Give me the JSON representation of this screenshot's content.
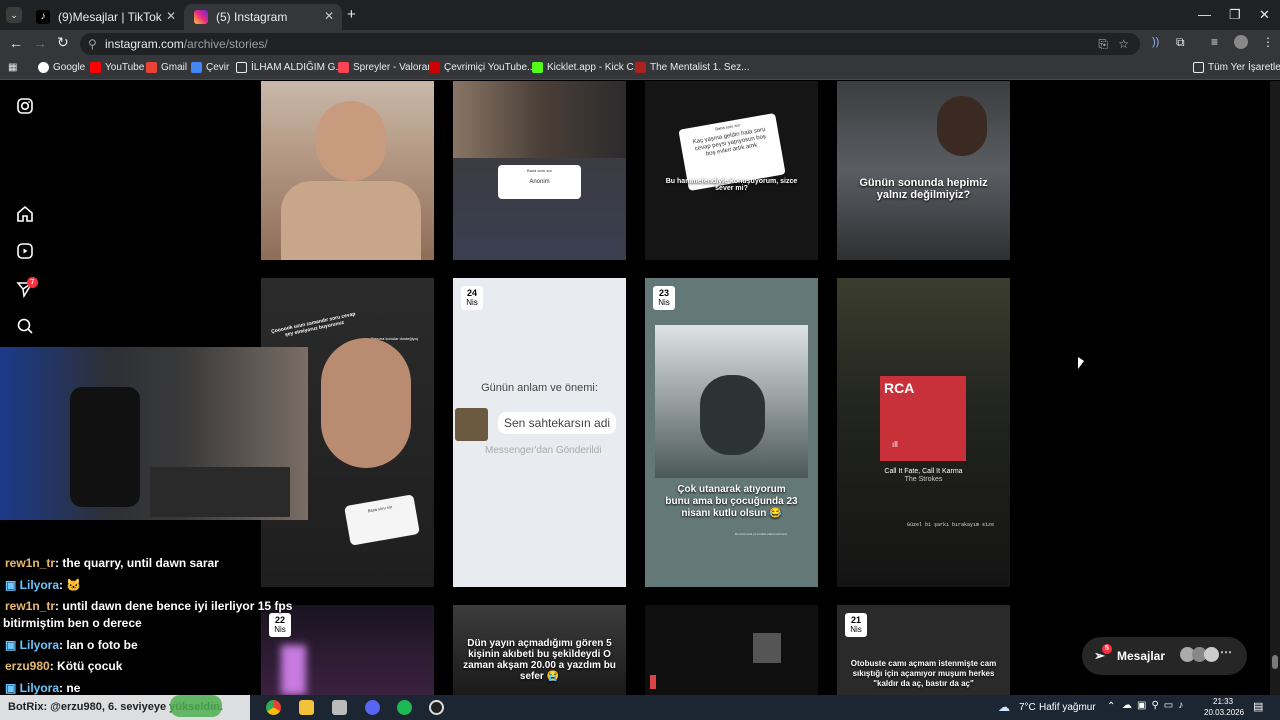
{
  "browser": {
    "tabs": [
      {
        "title": "(9)Mesajlar | TikTok",
        "active": false
      },
      {
        "title": "(5) Instagram",
        "active": true
      }
    ],
    "url_host": "instagram.com",
    "url_path": "/archive/stories/",
    "bookmarks": [
      "Google",
      "YouTube",
      "Gmail",
      "Çevir",
      "İLHAM ALDIĞIM G...",
      "Spreyler - Valorant",
      "Çevrimiçi YouTube...",
      "Kicklet.app - Kick C...",
      "The Mentalist 1. Sez..."
    ],
    "all_bookmarks": "Tüm Yer İşaretleri"
  },
  "sidebar": {
    "notification_badge": "7"
  },
  "stories": {
    "row1": [
      {
        "text": ""
      },
      {
        "question_box": "Anonim",
        "question_label": "Bana soru sor"
      },
      {
        "question_label": "Bana soru sor",
        "question_text": "Kaç yaşına geldin hala soru cevap peysi yapıyosun boş boş evleri artık amk",
        "caption": "Bu hanımefendiyle konuşuyorum, sizce sever mi?"
      },
      {
        "caption": "Günün sonunda hepimiz yalnız değilmiyiz?"
      }
    ],
    "row2": [
      {
        "top_text": "Çoooook uzun zamandır soru cevap şey etmiyoruz buyurunuz",
        "side_text": "(başına konular dosteğiyo)",
        "question_label": "Bana soru sor"
      },
      {
        "date_day": "24",
        "date_month": "Nis",
        "heading": "Günün anlam ve önemi:",
        "bubble": "Sen sahtekarsın adi",
        "footer": "Messenger'dan Gönderildi"
      },
      {
        "date_day": "23",
        "date_month": "Nis",
        "caption": "Çok utanarak atıyorum bunu ama bu çocuğunda 23 nisanı kutlu olsun 😂",
        "small": "Bu dizüt kadı ya sizdeki ufaldı üzülmezi"
      },
      {
        "album_label": "RCA",
        "song": "Call It Fate, Call It Karma",
        "artist": "The Strokes",
        "small": "Güzel bi şarkı bırakayım size"
      }
    ],
    "row3": [
      {
        "date_day": "22",
        "date_month": "Nis"
      },
      {
        "caption": "Dün yayın açmadığımı gören 5 kişinin akıbeti bu şekildeydi O zaman akşam 20.00 a yazdım bu sefer 😭"
      },
      {},
      {
        "date_day": "21",
        "date_month": "Nis",
        "caption": "Otobuste camı açmam istenmişte cam sıkıştığı için açamıyor muşum herkes \"kaldır da aç, bastır da aç\""
      }
    ]
  },
  "messages_button": {
    "label": "Mesajlar",
    "badge": "5"
  },
  "chat": [
    {
      "user": "rew1n_tr",
      "text": ": the quarry, until dawn sarar",
      "color": "n1"
    },
    {
      "user": "Lilyora",
      "text": ": 🐱",
      "color": "n2"
    },
    {
      "user": "rew1n_tr",
      "text": ": until dawn dene bence iyi ilerliyor 15 fps",
      "color": "n1"
    },
    {
      "user": "",
      "text": "bitirmiştim ben o derece",
      "color": ""
    },
    {
      "user": "Lilyora",
      "text": ": lan o foto be",
      "color": "n2"
    },
    {
      "user": "erzu980",
      "text": ": Kötü çocuk",
      "color": "n1"
    },
    {
      "user": "Lilyora",
      "text": ": ne",
      "color": "n2"
    }
  ],
  "notification_bar": "BotRix: @erzu980, 6. seviyeye yükseldin.",
  "taskbar": {
    "weather_temp": "7°C",
    "weather_desc": "Hafif yağmur",
    "time": "21:33",
    "date": "20.03.2026"
  }
}
